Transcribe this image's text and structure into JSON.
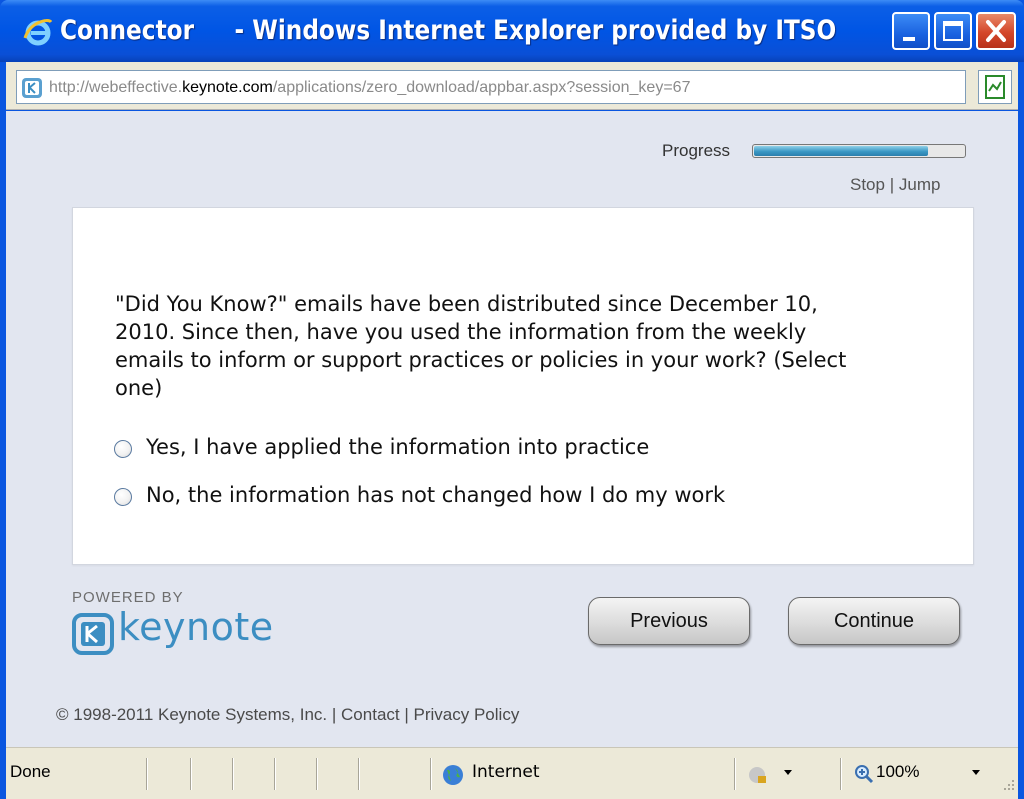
{
  "window": {
    "title": "Connector     - Windows Internet Explorer provided by ITSO"
  },
  "address": {
    "url_prefix": "http://webeffective.",
    "url_domain": "keynote.com",
    "url_suffix": "/applications/zero_download/appbar.aspx?session_key=67"
  },
  "toolbar": {
    "progress_label": "Progress",
    "progress_fraction": 0.83,
    "stop_link": "Stop",
    "separator": "|",
    "jump_link": "Jump"
  },
  "survey": {
    "question": "\"Did You Know?\" emails have been distributed since December 10, 2010. Since then, have you used the information from the weekly emails to inform or support practices or policies in your work? (Select one)",
    "options": [
      {
        "label": "Yes, I have applied the information into practice",
        "selected": false
      },
      {
        "label": "No, the information has not changed how I do my work",
        "selected": false
      }
    ]
  },
  "branding": {
    "powered_by": "POWERED BY",
    "logo_text": "keynote",
    "brand_color": "#3c8ec2"
  },
  "buttons": {
    "previous": "Previous",
    "continue": "Continue"
  },
  "footer": {
    "copyright": "© 1998-2011 Keynote Systems, Inc.",
    "contact": "Contact",
    "privacy": "Privacy Policy",
    "separator": "|"
  },
  "statusbar": {
    "status": "Done",
    "zone": "Internet",
    "zoom": "100%",
    "zone_icon": "globe-icon",
    "protected_mode_icon": "protected-mode-icon",
    "zoom_icon": "zoom-icon"
  }
}
